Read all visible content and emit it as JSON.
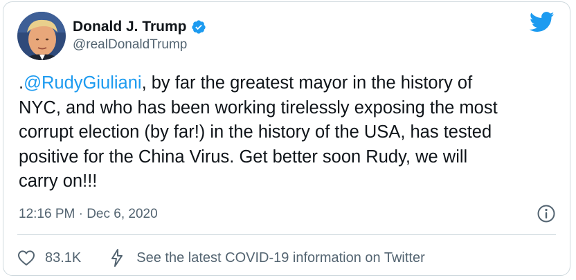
{
  "author": {
    "display_name": "Donald J. Trump",
    "handle": "@realDonaldTrump",
    "verified": true
  },
  "tweet": {
    "lines": [
      {
        "prefix": ".",
        "mention": "@RudyGiuliani",
        "rest": ", by far the greatest mayor in the history of"
      },
      {
        "text": "NYC, and who has been working tirelessly exposing the most"
      },
      {
        "text": "corrupt election (by far!) in the history of the USA, has tested"
      },
      {
        "text": "positive for the China Virus. Get better soon Rudy, we will"
      },
      {
        "text": "carry on!!!"
      }
    ],
    "timestamp": "12:16 PM · Dec 6, 2020"
  },
  "actions": {
    "likes": "83.1K",
    "covid_info": "See the latest COVID-19 information on Twitter"
  },
  "icons": {
    "logo": "twitter-bird-icon",
    "verified": "verified-badge-icon",
    "info": "info-icon",
    "like": "heart-icon",
    "notice": "lightning-icon"
  },
  "colors": {
    "accent": "#1d9bf0",
    "text": "#0f1419",
    "muted": "#536471",
    "border": "#cfd9de"
  }
}
